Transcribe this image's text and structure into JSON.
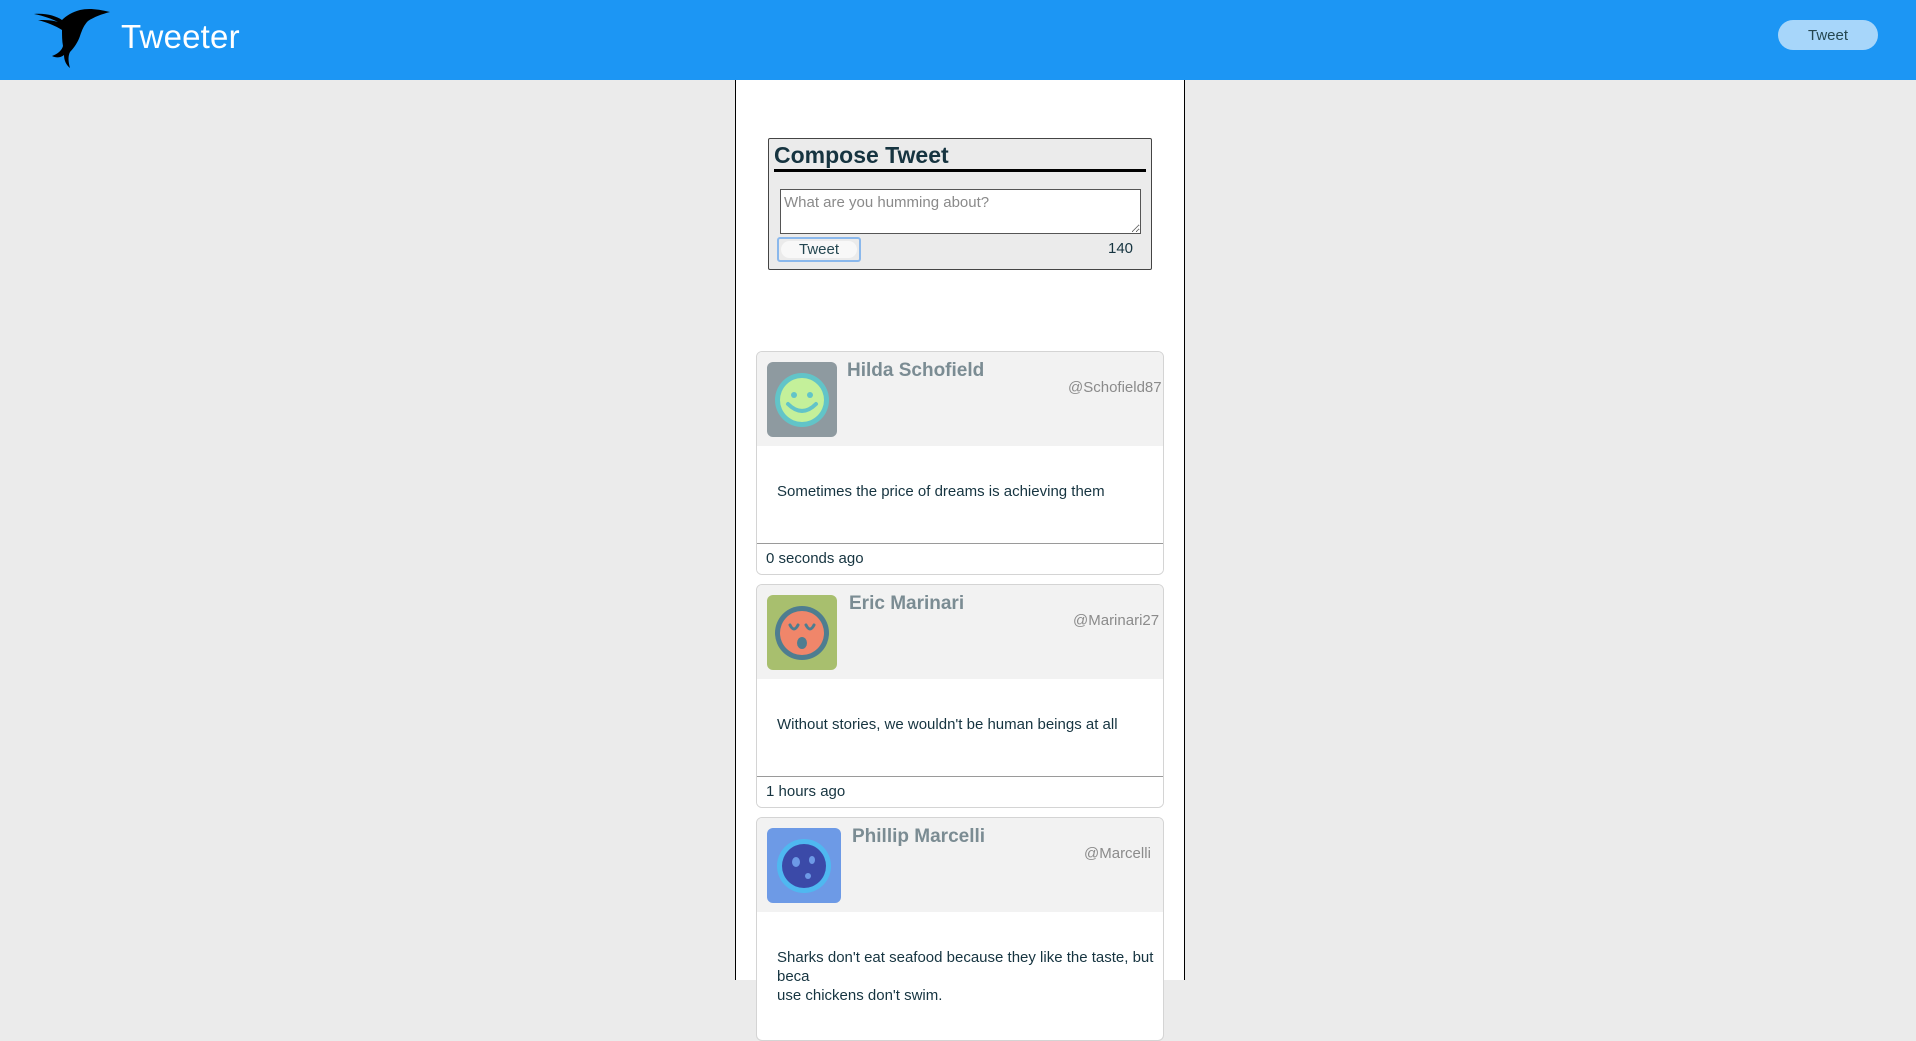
{
  "navbar": {
    "brand": "Tweeter",
    "compose_button": "Tweet",
    "logo_icon": "hummingbird-icon",
    "background": "#1c96f4"
  },
  "composer": {
    "title": "Compose Tweet",
    "placeholder": "What are you humming about?",
    "value": "",
    "submit_label": "Tweet",
    "counter": "140"
  },
  "tweets": [
    {
      "author": "Hilda Schofield",
      "handle": "@Schofield87",
      "text": "Sometimes the price of dreams is achieving them",
      "time": "0 seconds ago",
      "avatar_icon": "smiley-face-icon",
      "avatar_bg": "#8e9aa0"
    },
    {
      "author": "Eric Marinari",
      "handle": "@Marinari27",
      "text": "Without stories, we wouldn't be human beings at all",
      "time": "1 hours ago",
      "avatar_icon": "surprised-face-icon",
      "avatar_bg": "#a8bf6e"
    },
    {
      "author": "Phillip Marcelli",
      "handle": "@Marcelli",
      "text": "Sharks don't eat seafood because they like the taste, but beca\nuse chickens don't swim.",
      "time": "",
      "avatar_icon": "planet-face-icon",
      "avatar_bg": "#6d9ae6"
    }
  ]
}
